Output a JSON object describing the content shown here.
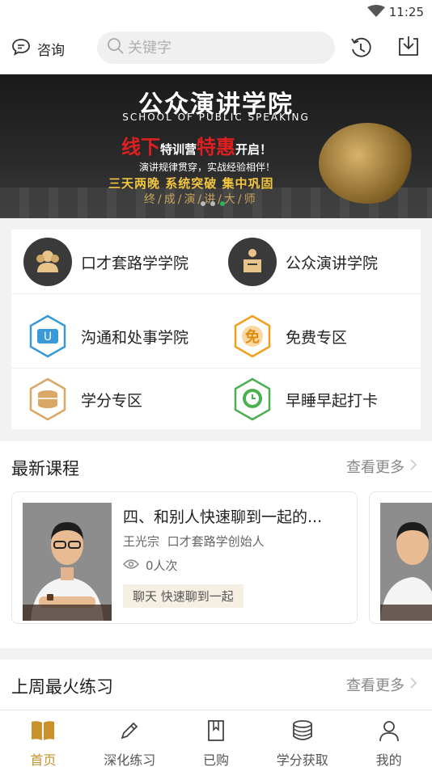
{
  "status": {
    "time": "11:25"
  },
  "topbar": {
    "consult_label": "咨询",
    "search_placeholder": "关键字"
  },
  "banner": {
    "title": "公众演讲学院",
    "subtitle": "SCHOOL OF PUBLIC SPEAKING",
    "line1_a": "线下",
    "line1_b": "特训营",
    "line1_c": "特惠",
    "line1_d": "开启！",
    "line2": "演讲规律贯穿，实战经验相伴！",
    "line3": "三天两晚  系统突破  集中巩固",
    "line4": "终/成/演/讲/大/师",
    "dots": 3,
    "active_dot": 2
  },
  "categories": [
    {
      "label": "口才套路学学院",
      "icon": "people-icon"
    },
    {
      "label": "公众演讲学院",
      "icon": "podium-icon"
    },
    {
      "label": "沟通和处事学院",
      "icon": "chat-icon"
    },
    {
      "label": "免费专区",
      "icon": "free-icon"
    },
    {
      "label": "学分专区",
      "icon": "coins-icon"
    },
    {
      "label": "早睡早起打卡",
      "icon": "clock-icon"
    }
  ],
  "latest_courses": {
    "title": "最新课程",
    "more_label": "查看更多",
    "items": [
      {
        "title": "四、和别人快速聊到一起的...",
        "author": "王光宗",
        "author_role": "口才套路学创始人",
        "views": "0人次",
        "tag": "聊天 快速聊到一起"
      }
    ]
  },
  "hot_practice": {
    "title": "上周最火练习",
    "more_label": "查看更多"
  },
  "tabbar": {
    "items": [
      {
        "label": "首页",
        "icon": "book-open-icon",
        "active": true
      },
      {
        "label": "深化练习",
        "icon": "pencil-icon",
        "active": false
      },
      {
        "label": "已购",
        "icon": "bookmark-book-icon",
        "active": false
      },
      {
        "label": "学分获取",
        "icon": "coins-stack-icon",
        "active": false
      },
      {
        "label": "我的",
        "icon": "user-icon",
        "active": false
      }
    ]
  },
  "colors": {
    "accent": "#c8912c",
    "dot_active": "#2ab55a",
    "banner_red": "#e02020",
    "banner_gold": "#f3c640"
  }
}
